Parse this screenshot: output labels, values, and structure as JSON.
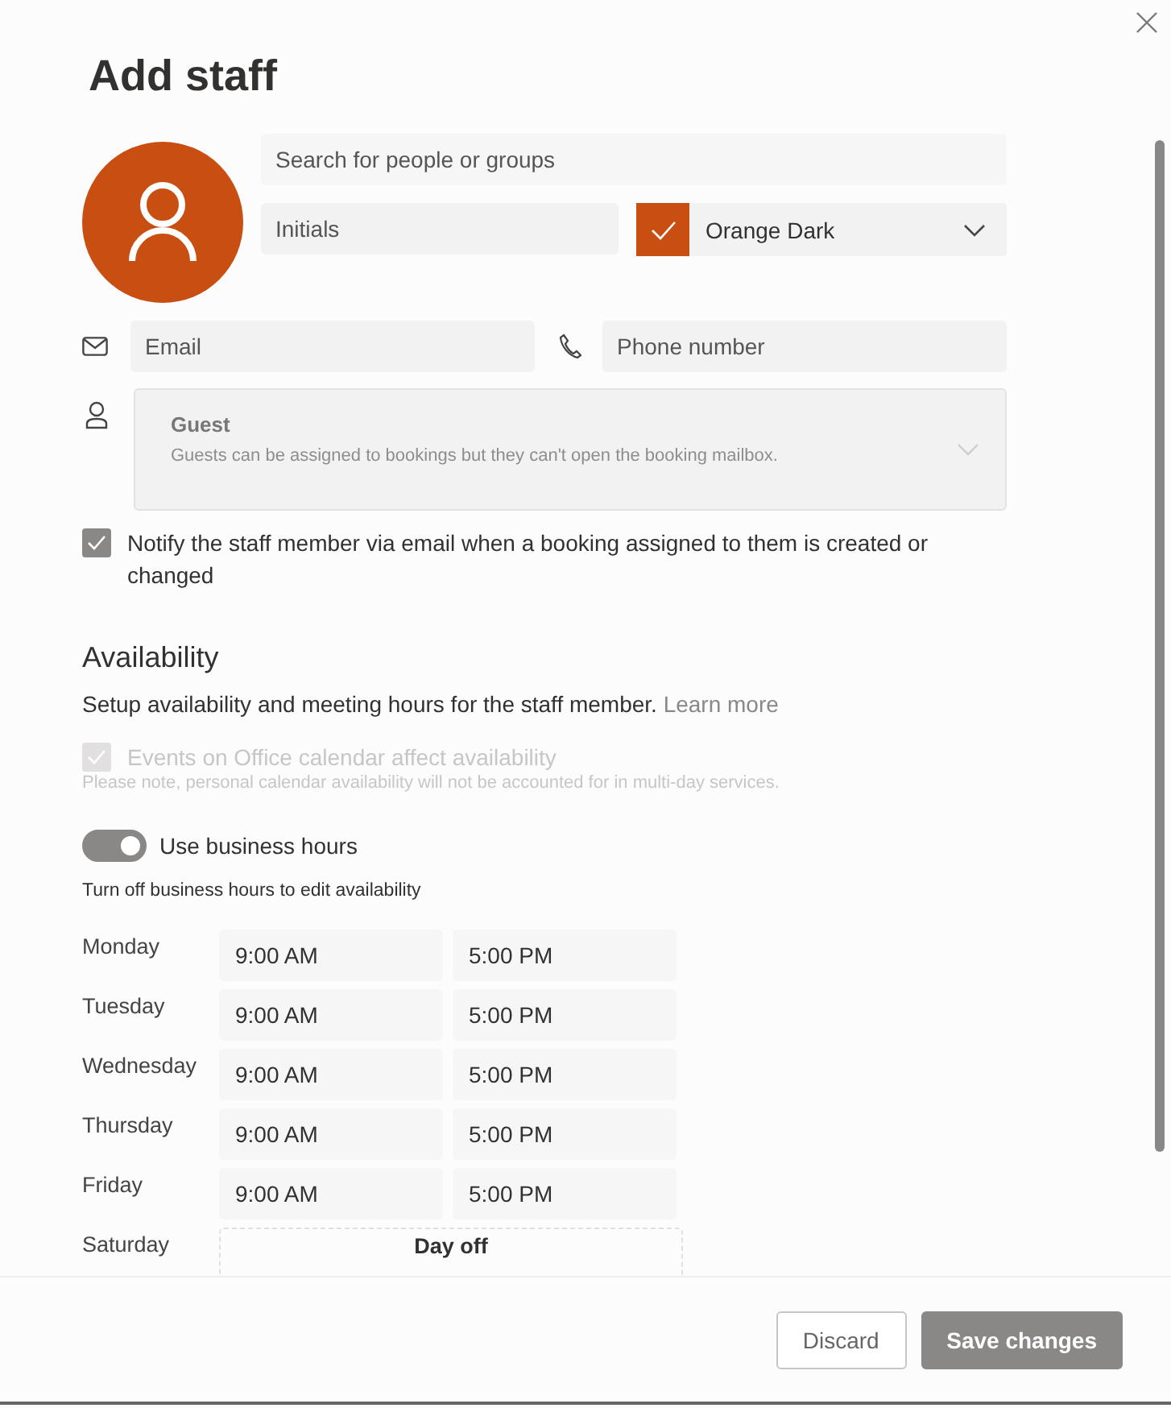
{
  "title": "Add staff",
  "search": {
    "placeholder": "Search for people or groups"
  },
  "initials": {
    "placeholder": "Initials"
  },
  "color_picker": {
    "label": "Orange Dark",
    "color": "#c84e12"
  },
  "email": {
    "placeholder": "Email"
  },
  "phone": {
    "placeholder": "Phone number"
  },
  "role": {
    "label": "Guest",
    "description": "Guests can be assigned to bookings but they can't open the booking mailbox.",
    "disabled": true
  },
  "notify": {
    "label": "Notify the staff member via email when a booking assigned to them is created or changed",
    "checked": true
  },
  "availability": {
    "heading": "Availability",
    "description": "Setup availability and meeting hours for the staff member.",
    "link": "Learn more"
  },
  "office_calendar": {
    "label": "Events on Office calendar affect availability",
    "note": "Please note, personal calendar availability will not be accounted for in multi-day services.",
    "checked": true,
    "disabled": true
  },
  "business_hours": {
    "label": "Use business hours",
    "on": true,
    "hint": "Turn off business hours to edit availability"
  },
  "schedule": [
    {
      "day": "Monday",
      "kind": "hours",
      "start": "9:00 AM",
      "end": "5:00 PM"
    },
    {
      "day": "Tuesday",
      "kind": "hours",
      "start": "9:00 AM",
      "end": "5:00 PM"
    },
    {
      "day": "Wednesday",
      "kind": "hours",
      "start": "9:00 AM",
      "end": "5:00 PM"
    },
    {
      "day": "Thursday",
      "kind": "hours",
      "start": "9:00 AM",
      "end": "5:00 PM"
    },
    {
      "day": "Friday",
      "kind": "hours",
      "start": "9:00 AM",
      "end": "5:00 PM"
    },
    {
      "day": "Saturday",
      "kind": "off",
      "label": "Day off"
    }
  ],
  "buttons": {
    "discard": "Discard",
    "save": "Save changes"
  }
}
